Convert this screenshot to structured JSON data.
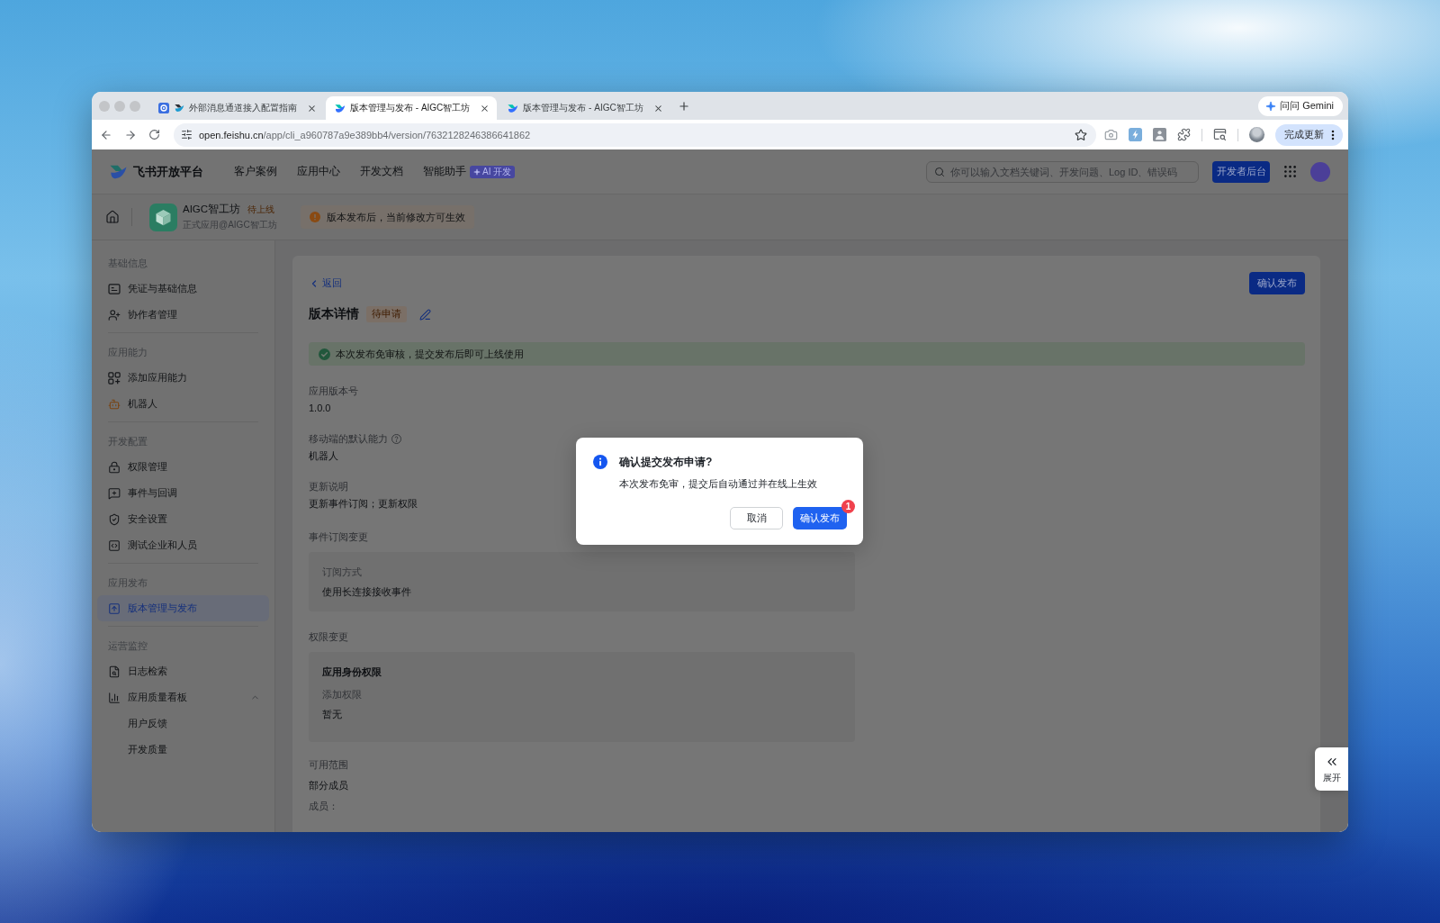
{
  "browser": {
    "tabs": [
      {
        "title": "外部消息通道接入配置指南",
        "selected": false
      },
      {
        "title": "版本管理与发布 - AIGC智工坊",
        "selected": true
      },
      {
        "title": "版本管理与发布 - AIGC智工坊",
        "selected": false
      }
    ],
    "gemini_button": "问问 Gemini",
    "url": {
      "host": "open.feishu.cn",
      "path": "/app/cli_a960787a9e389bb4/version/7632128246386641862"
    },
    "update_button": "完成更新"
  },
  "header": {
    "title": "飞书开放平台",
    "nav": [
      {
        "label": "客户案例"
      },
      {
        "label": "应用中心"
      },
      {
        "label": "开发文档"
      },
      {
        "label": "智能助手",
        "tag": "AI 开发"
      }
    ],
    "search": {
      "placeholder": "你可以输入文档关键词、开发问题、Log ID、错误码"
    },
    "console_button": "开发者后台"
  },
  "app_bar": {
    "name": "AIGC智工坊",
    "status": "待上线",
    "subtitle": "正式应用@AIGC智工坊",
    "notice": "版本发布后，当前修改方可生效"
  },
  "sidebar": {
    "groups": [
      {
        "title": "基础信息",
        "items": [
          {
            "label": "凭证与基础信息",
            "selected": false
          },
          {
            "label": "协作者管理",
            "selected": false
          }
        ]
      },
      {
        "title": "应用能力",
        "items": [
          {
            "label": "添加应用能力",
            "selected": false
          },
          {
            "label": "机器人",
            "selected": false
          }
        ]
      },
      {
        "title": "开发配置",
        "items": [
          {
            "label": "权限管理",
            "selected": false
          },
          {
            "label": "事件与回调",
            "selected": false
          },
          {
            "label": "安全设置",
            "selected": false
          },
          {
            "label": "测试企业和人员",
            "selected": false
          }
        ]
      },
      {
        "title": "应用发布",
        "items": [
          {
            "label": "版本管理与发布",
            "selected": true
          }
        ]
      },
      {
        "title": "运营监控",
        "items": [
          {
            "label": "日志检索",
            "selected": false
          },
          {
            "label": "应用质量看板",
            "selected": false,
            "expanded": true,
            "children": [
              {
                "label": "用户反馈",
                "selected": false
              },
              {
                "label": "开发质量",
                "selected": false
              }
            ]
          }
        ]
      }
    ]
  },
  "content": {
    "back_link": "返回",
    "publish_button": "确认发布",
    "title": "版本详情",
    "status": "待申请",
    "banner": "本次发布免审核，提交发布后即可上线使用",
    "fields": [
      {
        "kind": "plain",
        "label": "应用版本号",
        "value": "1.0.0"
      },
      {
        "kind": "with_help",
        "label": "移动端的默认能力",
        "value": "机器人"
      },
      {
        "kind": "plain",
        "label": "更新说明",
        "value": "更新事件订阅；更新权限"
      }
    ],
    "changes": [
      {
        "title": "事件订阅变更",
        "lines": [
          {
            "kind": "label",
            "text": "订阅方式"
          },
          {
            "kind": "value",
            "text": "使用长连接接收事件"
          }
        ]
      },
      {
        "title": "权限变更",
        "lines": [
          {
            "kind": "heading",
            "text": "应用身份权限"
          },
          {
            "kind": "label",
            "text": "添加权限"
          },
          {
            "kind": "value",
            "text": "暂无"
          }
        ]
      }
    ],
    "scope": {
      "label": "可用范围",
      "value": "部分成员",
      "members_label": "成员："
    }
  },
  "dialog": {
    "title": "确认提交发布申请?",
    "message": "本次发布免审，提交后自动通过并在线上生效",
    "cancel_button": "取消",
    "confirm_button": "确认发布",
    "badge": "1"
  },
  "expand_button": "展开"
}
